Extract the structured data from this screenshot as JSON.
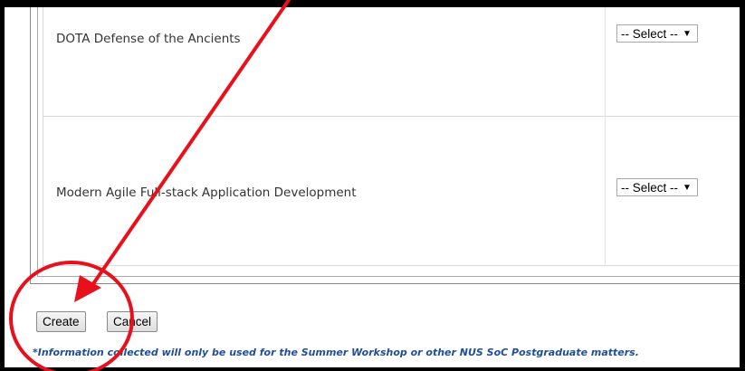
{
  "courses": [
    {
      "name": "DOTA Defense of the Ancients",
      "selection": "-- Select --"
    },
    {
      "name": "Modern Agile Full-stack Application Development",
      "selection": "-- Select --"
    }
  ],
  "buttons": {
    "create": "Create",
    "cancel": "Cancel"
  },
  "footnote": "*Information collected will only be used for the Summer Workshop or other NUS SoC Postgraduate matters.",
  "annotation_color": "#e8101a",
  "note_color": "#1f4e9a"
}
